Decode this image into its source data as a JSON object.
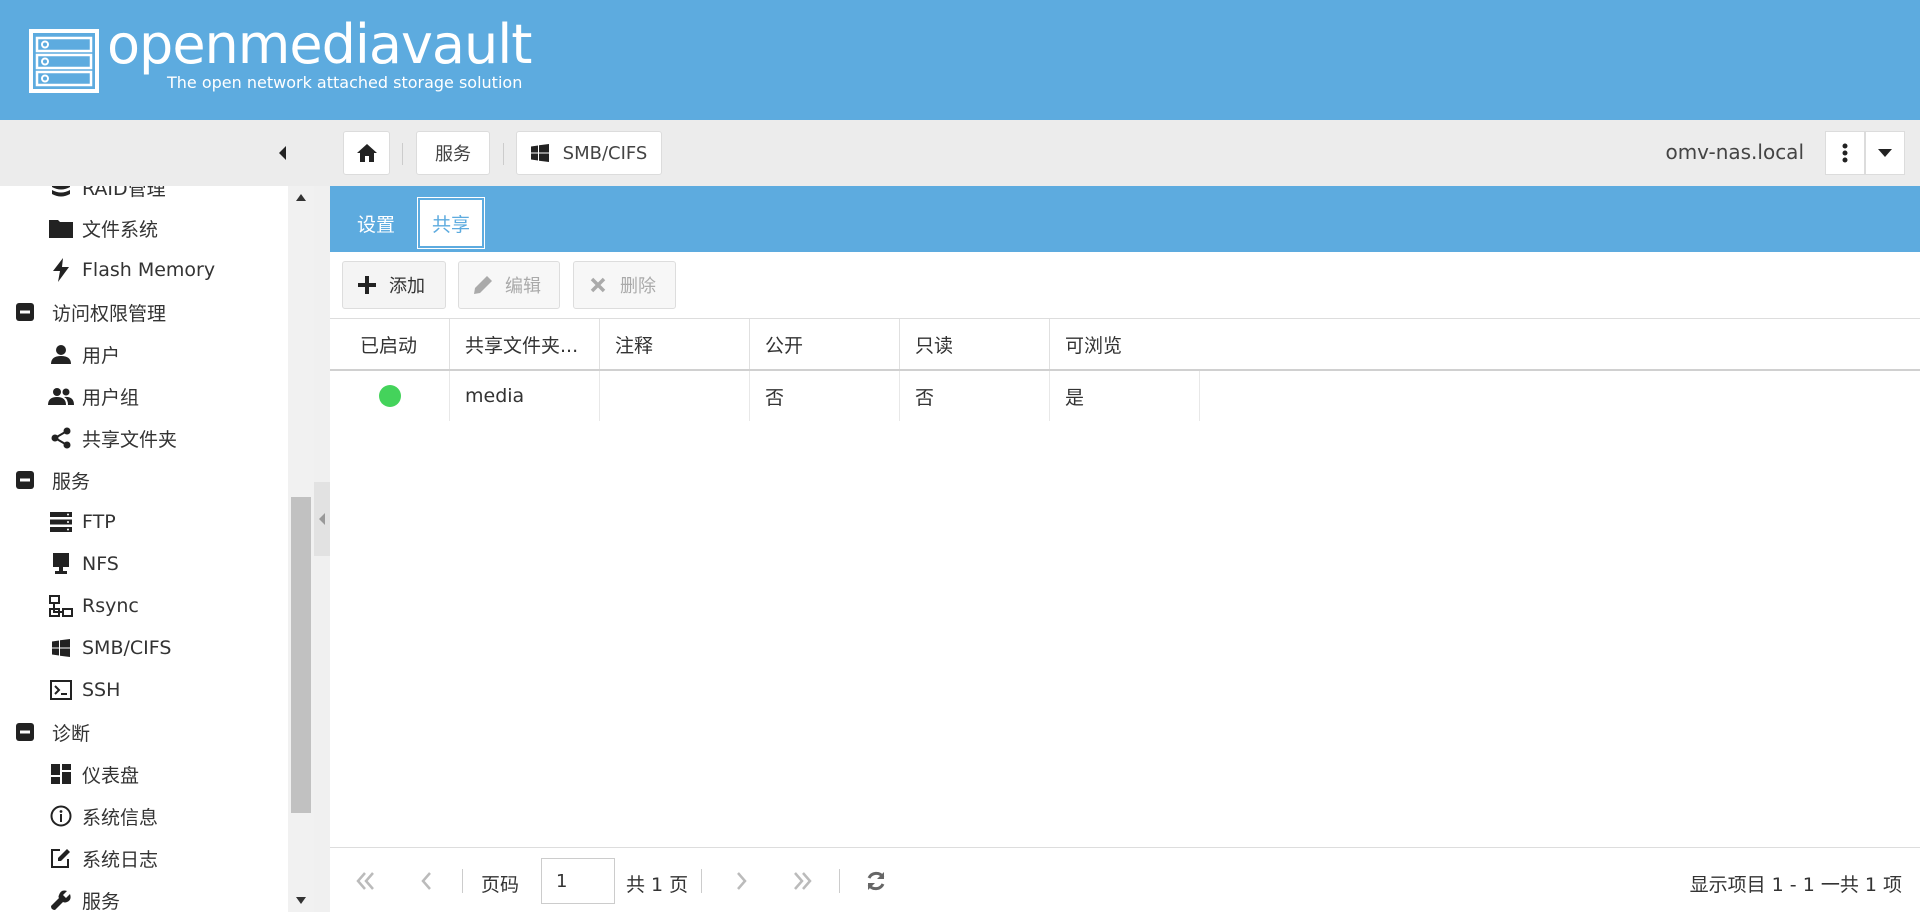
{
  "header": {
    "brand": "openmediavault",
    "tagline": "The open network attached storage solution"
  },
  "toolbar": {
    "breadcrumb": [
      "服务",
      "SMB/CIFS"
    ],
    "hostname": "omv-nas.local"
  },
  "sidebar": {
    "items": [
      {
        "label": "RAID管理",
        "icon": "database-icon",
        "level": "child"
      },
      {
        "label": "文件系统",
        "icon": "folder-icon",
        "level": "child"
      },
      {
        "label": "Flash Memory",
        "icon": "flash-icon",
        "level": "child"
      },
      {
        "label": "访问权限管理",
        "icon": "minus-square-icon",
        "level": "group"
      },
      {
        "label": "用户",
        "icon": "user-icon",
        "level": "child"
      },
      {
        "label": "用户组",
        "icon": "users-icon",
        "level": "child"
      },
      {
        "label": "共享文件夹",
        "icon": "share-icon",
        "level": "child"
      },
      {
        "label": "服务",
        "icon": "minus-square-icon",
        "level": "group"
      },
      {
        "label": "FTP",
        "icon": "server-icon",
        "level": "child"
      },
      {
        "label": "NFS",
        "icon": "desktop-icon",
        "level": "child"
      },
      {
        "label": "Rsync",
        "icon": "sitemap-icon",
        "level": "child"
      },
      {
        "label": "SMB/CIFS",
        "icon": "windows-icon",
        "level": "child"
      },
      {
        "label": "SSH",
        "icon": "terminal-icon",
        "level": "child"
      },
      {
        "label": "诊断",
        "icon": "minus-square-icon",
        "level": "group"
      },
      {
        "label": "仪表盘",
        "icon": "dashboard-icon",
        "level": "child"
      },
      {
        "label": "系统信息",
        "icon": "info-icon",
        "level": "child"
      },
      {
        "label": "系统日志",
        "icon": "edit-icon",
        "level": "child"
      },
      {
        "label": "服务",
        "icon": "wrench-icon",
        "level": "child"
      }
    ]
  },
  "tabs": [
    {
      "label": "设置",
      "active": false
    },
    {
      "label": "共享",
      "active": true
    }
  ],
  "actions": {
    "add": "添加",
    "edit": "编辑",
    "delete": "删除"
  },
  "grid": {
    "columns": [
      "已启动",
      "共享文件夹...",
      "注释",
      "公开",
      "只读",
      "可浏览"
    ],
    "rows": [
      {
        "enabled": true,
        "shared_folder": "media",
        "comment": "",
        "public": "否",
        "readonly": "否",
        "browseable": "是"
      }
    ]
  },
  "pager": {
    "page_label": "页码",
    "page_value": "1",
    "total_pages": "共 1 页",
    "summary": "显示项目 1 - 1 一共 1 项"
  },
  "colors": {
    "brand_blue": "#5dabdf",
    "enabled_green": "#44d35b"
  }
}
